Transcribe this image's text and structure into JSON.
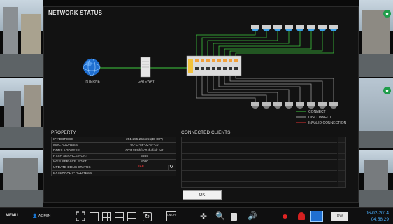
{
  "dialog": {
    "title": "NETWORK STATUS"
  },
  "topology": {
    "internet_label": "INTERNET",
    "gateway_label": "GATEWAY"
  },
  "legend": {
    "items": [
      {
        "label": "CONNECT",
        "color": "#3ec93e"
      },
      {
        "label": "DISCONNECT",
        "color": "#9a9a9a"
      },
      {
        "label": "INVALID CONNECTION",
        "color": "#e03030"
      }
    ]
  },
  "property": {
    "title": "PROPERTY",
    "rows": [
      {
        "key": "IP ADDRESS",
        "value": "251.255.255.255(DHCP)"
      },
      {
        "key": "MAC ADDRESS",
        "value": "00-11-5F-02-6F-c0"
      },
      {
        "key": "DDNS ADDRESS",
        "value": "0011SF0bfdc0.dvrlink.net"
      },
      {
        "key": "RTSP SERVICE PORT",
        "value": "5554"
      },
      {
        "key": "WEB SERVICE PORT",
        "value": "8080"
      },
      {
        "key": "UPDATE DDNS STATUS",
        "value": "FAIL"
      },
      {
        "key": "EXTERNAL IP ADDRESS",
        "value": ""
      }
    ]
  },
  "clients": {
    "title": "CONNECTED CLIENTS"
  },
  "buttons": {
    "ok_label": "OK"
  },
  "taskbar": {
    "menu_label": "MENU",
    "user_label": "ADMIN",
    "audio_toggle_label": "ON/OFF",
    "dw_label": "DW",
    "date": "06-02-2014",
    "time": "04:58:29"
  },
  "colors": {
    "connect_line": "#3ec93e",
    "disconnect_line": "#9a9a9a",
    "camera_active": "#3aa0e8",
    "accent_time": "#4ab0ff"
  }
}
